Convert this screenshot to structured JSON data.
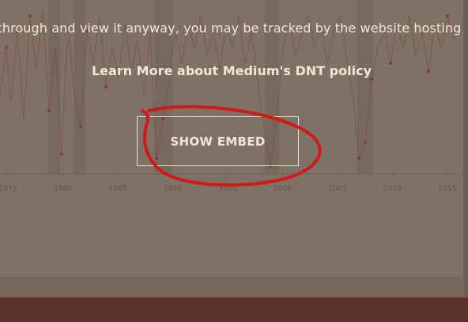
{
  "embed": {
    "notice_text": "If you click through and view it anyway, you may be tracked by the website hosting the embed.",
    "learn_more_label": "Learn More about Medium's DNT policy",
    "show_embed_label": "SHOW EMBED"
  },
  "background_chart": {
    "x_ticks": [
      "1975",
      "1980",
      "1985",
      "1990",
      "1995",
      "2000",
      "2005",
      "2010",
      "2015"
    ]
  },
  "colors": {
    "overlay": "#7f7166",
    "page_background": "#5b3129",
    "text": "#f2e6d3",
    "annotation_stroke": "#d01a18",
    "data_marker": "#8a2c24"
  },
  "annotation": {
    "type": "hand-drawn red ellipse",
    "target": "SHOW EMBED button"
  }
}
